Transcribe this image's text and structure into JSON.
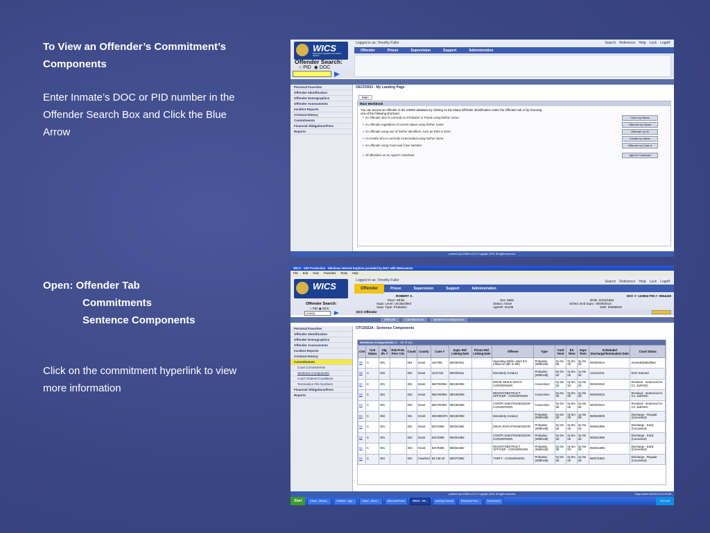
{
  "slide": {
    "para1": [
      "To View an Offender’s Commitment’s",
      "Components"
    ],
    "para2": [
      "Enter Inmate’s DOC or PID number in the",
      "Offender Search Box and Click the Blue",
      "Arrow"
    ],
    "para3": {
      "line1": "Open:  Offender Tab",
      "line2": "Commitments",
      "line3": "Sentence Components"
    },
    "para4": [
      "Click on the commitment hyperlink to view",
      "more information"
    ]
  },
  "shot1": {
    "logged_in": "Logged in as: Timothy Fuller",
    "top_links": [
      "Search",
      "Reference",
      "Help",
      "Lock",
      "Logoff"
    ],
    "nav_tabs": [
      "Offender",
      "Prison",
      "Supervision",
      "Support",
      "Administration"
    ],
    "logo_text": "WICS",
    "logo_sub": "Wisconsin Integrated Corrections System",
    "search_label": "Offender Search:",
    "radio_pid": "PID",
    "radio_doc": "DOC",
    "side_items": [
      "Personal Favorites",
      "Offender Identification",
      "Offender Demographics",
      "Offender Assessments",
      "Incident Reports",
      "Criminal History",
      "Commitments",
      "Financial Obligations/Fees",
      "Reports"
    ],
    "page_title": "OECF5553 - My Landing Page",
    "tab_main": "Main",
    "section": "Main Workbook",
    "intro": "You can access an offender in the eOMIS database by clicking on the status Offender Identification under the Offender tab or by choosing one of the following shortcuts:",
    "bullets": [
      "An offender who is currently on Probation or Parole using his/her name:",
      "An offender regardless of current status using his/her name:",
      "An offender using one of his/her identifiers, such as SSN or DOC:",
      "An inmate who is currently incarcerated using his/her name:",
      "An offender using Court and Case Number:",
      "All offenders on an Agent's Caseload:"
    ],
    "buttons": [
      "Client by Name",
      "Offender by Name",
      "Offender by ID",
      "Inmate by Name",
      "Offender by Case #",
      "Agent's Caseload"
    ],
    "footer": "powered by eOMIS v4.9 © Copyright 2006. All rights reserved."
  },
  "shot2": {
    "window_title": "WICS - VEP Production - Windows Internet Explorer provided by DOC with Webcomms",
    "menu": [
      "File",
      "Edit",
      "View",
      "Favorites",
      "Tools",
      "Help"
    ],
    "logged_in": "Logged in as: Timothy Fuller",
    "top_links": [
      "Search",
      "Reference",
      "Help",
      "Lock",
      "Logoff"
    ],
    "nav_tabs": [
      "Offender",
      "Prison",
      "Supervision",
      "Support",
      "Administration"
    ],
    "logo_text": "WICS",
    "search_label": "Offender Search:",
    "radio_pid": "PID",
    "radio_doc": "DOC",
    "search_value": "133934",
    "offender_name": "ROBERT A.",
    "doc_line": "DOC #: 133934  PID #: 0654419",
    "race": "Race: White",
    "sex": "Sex: Male",
    "dob": "DOB: 11/04/1962",
    "supv_level": "Supv. Level: Unclassified",
    "status": "Status: Active",
    "sched_end": "Sched. End Supv.: 06/29/2014",
    "supv_type": "Supv. Type: Probation",
    "agent": "Agent#: 01235",
    "ssd": "SSD: 00265519",
    "dcc": "DCC Offender",
    "breadcrumb": [
      "Offender",
      "Commitments",
      "Sentence Components"
    ],
    "side_items": [
      "Personal Favorites",
      "Offender Identification",
      "Offender Demographics",
      "Offender Assessments",
      "Incident Reports",
      "Criminal History",
      "Commitments",
      "Court Commitments",
      "Sentence Components",
      "Court Ordered Conditions",
      "Termination File Numbers",
      "Financial Obligations/Fees",
      "Reports"
    ],
    "page_title": "OTCS022A - Sentence Components",
    "table_title": "Sentence Components",
    "table_count": "(1 - 10 of 10)",
    "columns": [
      "Cmt",
      "Cmt Status",
      "Jdg. Sh. #",
      "Rsk Prob. Prior Cnt.",
      "Count",
      "County",
      "Case #",
      "Supv. Ref. Linking Date",
      "Prison Ref. Linking Date",
      "Offense",
      "Type",
      "Conf Term",
      "ES Term",
      "Supv Term",
      "Scheduled Discharge/Termination Date",
      "Court Status"
    ],
    "rows": [
      [
        "05",
        "A",
        "001",
        "",
        "001",
        "Grant",
        "10CF55",
        "06/29/2011",
        "",
        "Operating While under the Influence (5th or 6th)",
        "Probation (Withheld)",
        "0y 0m 0d",
        "0y 0m 0d",
        "3y 0m 0d",
        "06/29/2014",
        "Amended/Modified"
      ],
      [
        "06",
        "A",
        "002",
        "",
        "001",
        "Grant",
        "11CF110",
        "06/29/2011",
        "",
        "Disorderly Conduct",
        "Probation (Withheld)",
        "0y 0m 0d",
        "0y 0m 0d",
        "1y 0m 0d",
        "11/21/2012",
        "DOC Entered"
      ],
      [
        "03",
        "C",
        "001",
        "",
        "001",
        "Grant",
        "08CF00064",
        "08/19/2008",
        "",
        "DRIVE WHILE INTOX - CONVERSION",
        "Conversion",
        "0y 0m 0d",
        "0y 0m 0d",
        "2y 0m 0d",
        "08/19/2010",
        "Revoked - Sentenced to Co. Jail/HOC"
      ],
      [
        "03",
        "C",
        "001",
        "",
        "002",
        "Grant",
        "08CF00064",
        "08/19/2008",
        "",
        "RESIST/OBSTRUCT OFFICER - CONVERSION",
        "Conversion",
        "0y 0m 0d",
        "0y 0m 0d",
        "2y 0m 0d",
        "08/19/2010",
        "Revoked - Sentenced to Co. Jail/HOC"
      ],
      [
        "03",
        "C",
        "001",
        "",
        "003",
        "Grant",
        "08CF00064",
        "08/19/2008",
        "",
        "CONTR SUB-POSSESSION - CONVERSION",
        "Conversion",
        "0y 0m 0d",
        "0y 0m 0d",
        "2y 0m 0d",
        "08/19/2010",
        "Revoked - Sentenced to Co. Jail/HOC"
      ],
      [
        "04",
        "C",
        "002",
        "",
        "001",
        "Grant",
        "08CM00374",
        "08/19/2008",
        "",
        "Disorderly Conduct",
        "Probation (Withheld)",
        "0y 0m 0d",
        "0y 0m 0d",
        "1y 0m 0d",
        "08/30/2009",
        "Discharge - Regular (Converted)"
      ],
      [
        "02",
        "C",
        "001",
        "",
        "001",
        "Grant",
        "92CR289",
        "09/25/1992",
        "",
        "DRUG PARA-POSSESSION",
        "Probation (Withheld)",
        "0y 0m 0d",
        "0y 0m 0d",
        "3y 0m 0d",
        "09/25/1995",
        "Discharge - Early (Converted)"
      ],
      [
        "02",
        "C",
        "001",
        "",
        "002",
        "Grant",
        "92CR289",
        "09/25/1992",
        "",
        "CONTR SUB-POSSESSION - CONVERSION",
        "Probation (Withheld)",
        "0y 0m 0d",
        "0y 0m 0d",
        "3y 0m 0d",
        "09/25/1995",
        "Discharge - Early (Converted)"
      ],
      [
        "02",
        "C",
        "001",
        "",
        "003",
        "Grant",
        "92CR289",
        "09/25/1992",
        "",
        "RESIST/OBSTRUCT OFFICER - CONVERSION",
        "Probation (Withheld)",
        "0y 0m 0d",
        "0y 0m 0d",
        "3y 0m 0d",
        "09/25/1995",
        "Discharge - Early (Converted)"
      ],
      [
        "01",
        "C",
        "001",
        "",
        "001",
        "Crawford",
        "82-CM-43",
        "06/07/1982",
        "",
        "THEFT - CONVERSION",
        "Probation (Withheld)",
        "0y 0m 0d",
        "0y 0m 0d",
        "2y 0m 0d",
        "06/07/1984",
        "Discharge - Regular (Converted)"
      ]
    ],
    "footer": "powered by eOMIS v4.9 © Copyright 2006. All rights reserved.",
    "footer_right": "Page loaded 9/4/2012 8:11:29 AM",
    "taskbar": [
      "Start",
      "Inbox - Micros...",
      "Untitled - App...",
      "Inbox - Micro...",
      "Microsoft Excel",
      "WICS - VE...",
      "training manual",
      "Microsoft Pow...",
      "Document1"
    ],
    "clock": "8:11 AM"
  }
}
